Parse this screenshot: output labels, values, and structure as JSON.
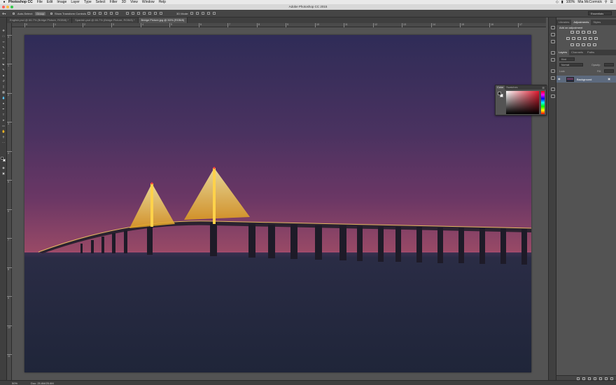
{
  "menubar": {
    "app": "Photoshop CC",
    "items": [
      "File",
      "Edit",
      "Image",
      "Layer",
      "Type",
      "Select",
      "Filter",
      "3D",
      "View",
      "Window",
      "Help"
    ],
    "battery": "100%",
    "user": "Mia McCormick"
  },
  "window": {
    "title": "Adobe Photoshop CC 2015"
  },
  "options": {
    "auto_select_label": "Auto-Select:",
    "auto_select_value": "Group",
    "show_transform": "Show Transform Controls",
    "mode3d": "3D Mode:",
    "workspace": "Essentials"
  },
  "tabs": [
    {
      "label": "English.psd @ 66.7% (Bridge Picture, RGB/8) *",
      "active": false
    },
    {
      "label": "Spanish.psd @ 66.7% (Bridge Picture, RGB/8) *",
      "active": false
    },
    {
      "label": "Bridge Picture.jpg @ 50% (RGB/8)",
      "active": true
    }
  ],
  "ruler": {
    "h": [
      "0",
      "1",
      "2",
      "3",
      "4",
      "5",
      "6",
      "7",
      "8",
      "9",
      "10",
      "11",
      "12",
      "13",
      "14",
      "15",
      "16",
      "17"
    ],
    "v": [
      "0",
      "1",
      "2",
      "3",
      "4",
      "5",
      "6",
      "7",
      "8",
      "9",
      "10",
      "11"
    ]
  },
  "status": {
    "zoom": "50%",
    "doc": "Doc: 25.6M/25.6M"
  },
  "adjust_panel": {
    "tabs": [
      "Libraries",
      "Adjustments",
      "Styles"
    ],
    "title": "Add an adjustment"
  },
  "layers_panel": {
    "tabs": [
      "Layers",
      "Channels",
      "Paths"
    ],
    "kind": "Kind",
    "blend": "Normal",
    "opacity_label": "Opacity:",
    "lock_label": "Lock:",
    "fill_label": "Fill:",
    "layer_name": "Background"
  },
  "color_panel": {
    "tabs": [
      "Color",
      "Swatches"
    ]
  },
  "colors": {
    "sky_top": "#2f2c57",
    "sky_mid": "#6b3765",
    "sky_horizon": "#9a4a66",
    "water": "#262b42",
    "bridge_lights": "#ffd24a",
    "layer_selected": "#5d6a7e"
  }
}
